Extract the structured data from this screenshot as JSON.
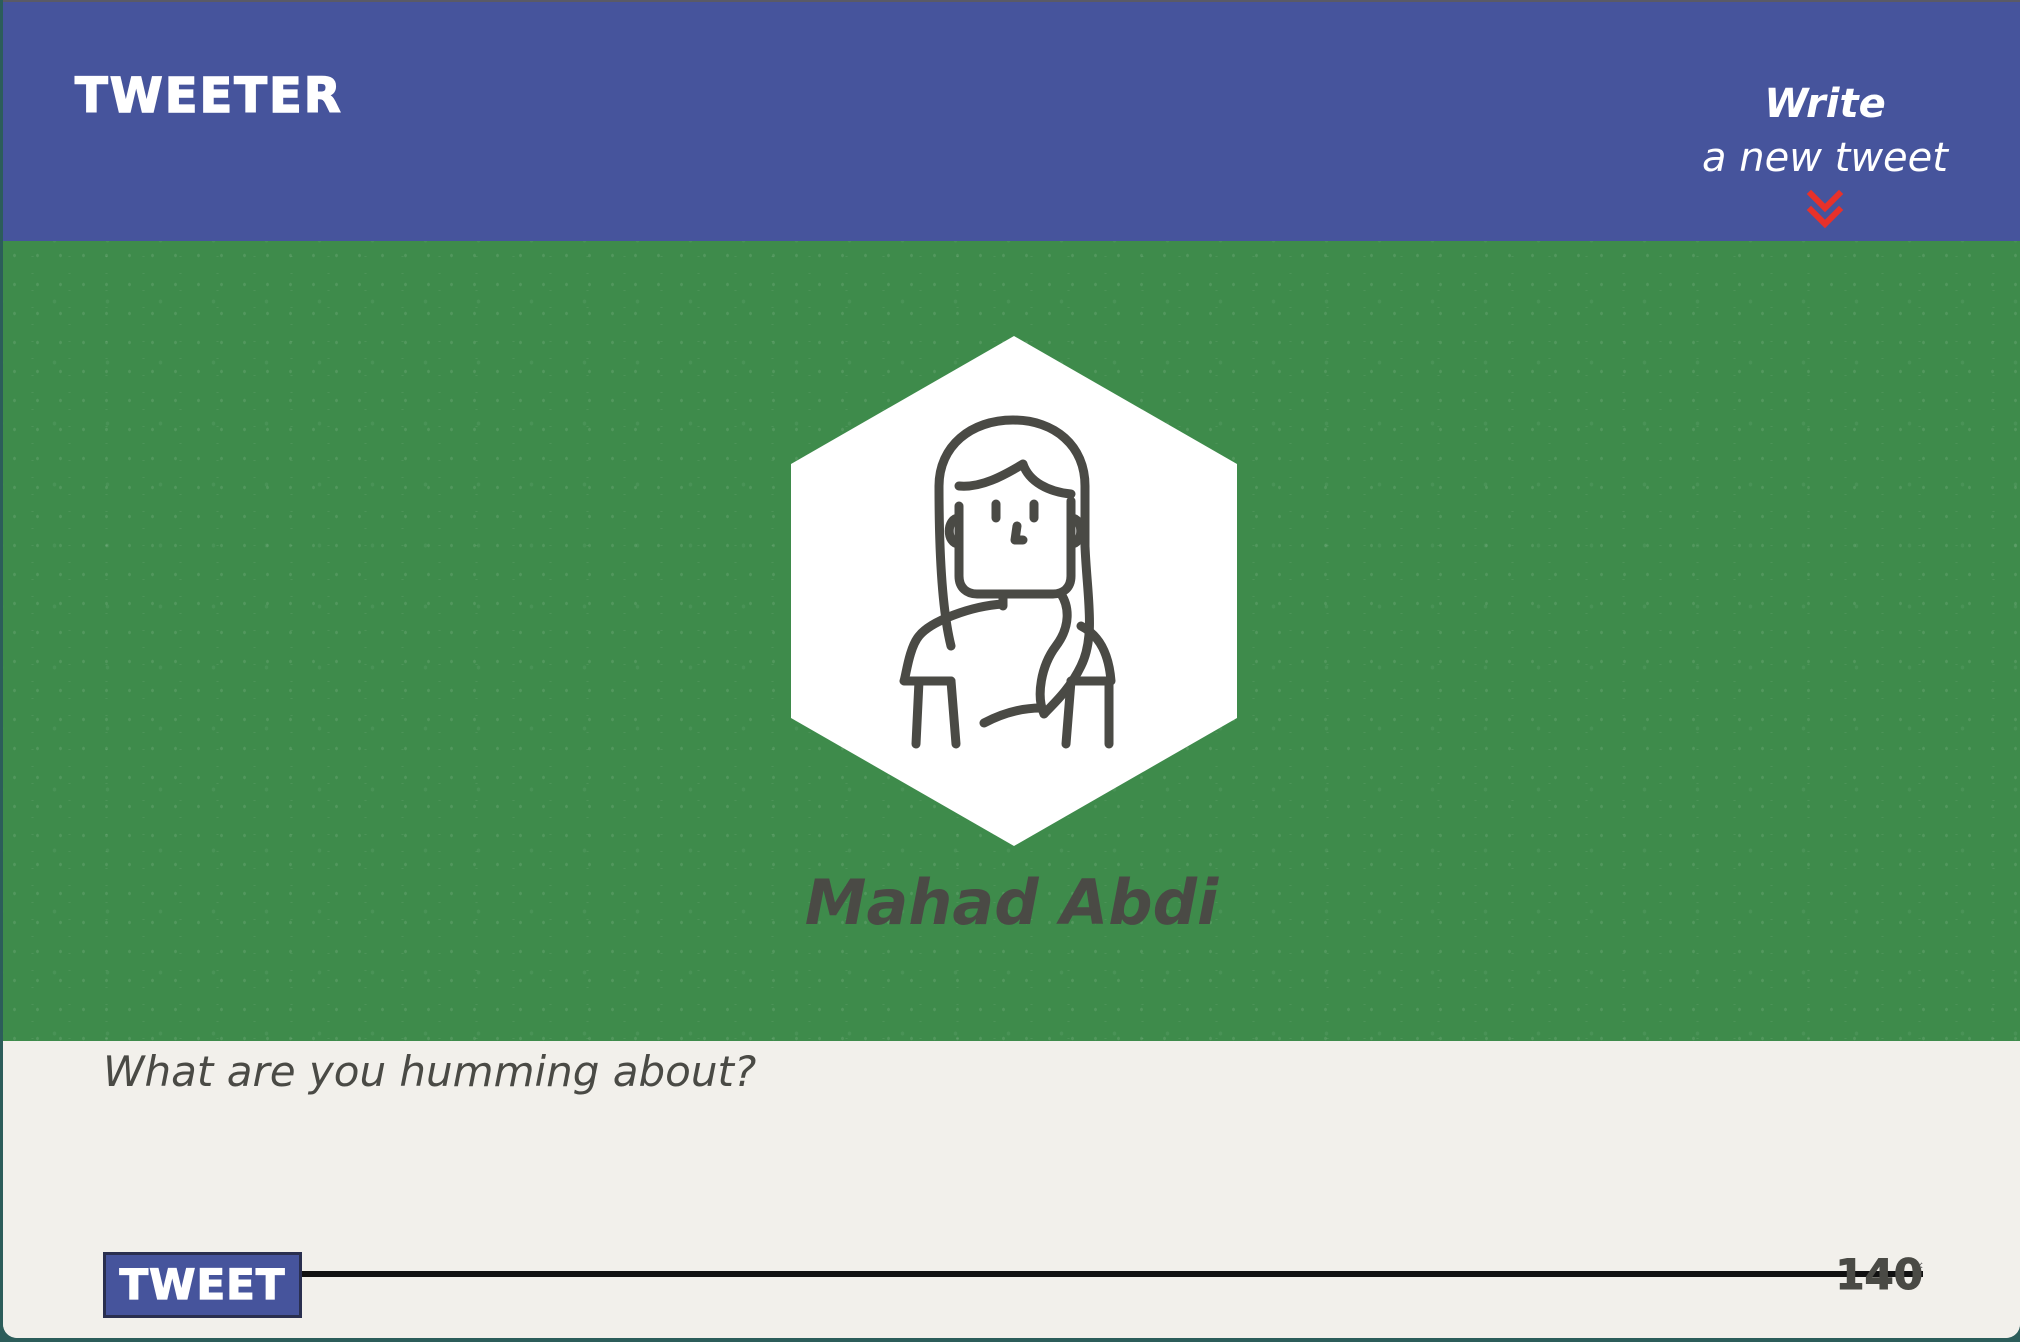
{
  "navbar": {
    "brand": "TWEETER",
    "compose_toggle": {
      "line1": "Write",
      "line2": "a new tweet",
      "icon": "double-chevron-down-icon"
    }
  },
  "profile": {
    "avatar_icon": "woman-avatar-icon",
    "name": "Mahad Abdi"
  },
  "composer": {
    "placeholder": "What are you humming about?",
    "value": "",
    "tweet_button_label": "TWEET",
    "char_count": "140"
  },
  "colors": {
    "navbar_bg": "#46549c",
    "profile_bg": "#3e8b4b",
    "composer_bg": "#f2f0eb",
    "accent_red": "#e8312a",
    "text_dark": "#4a4a45"
  }
}
